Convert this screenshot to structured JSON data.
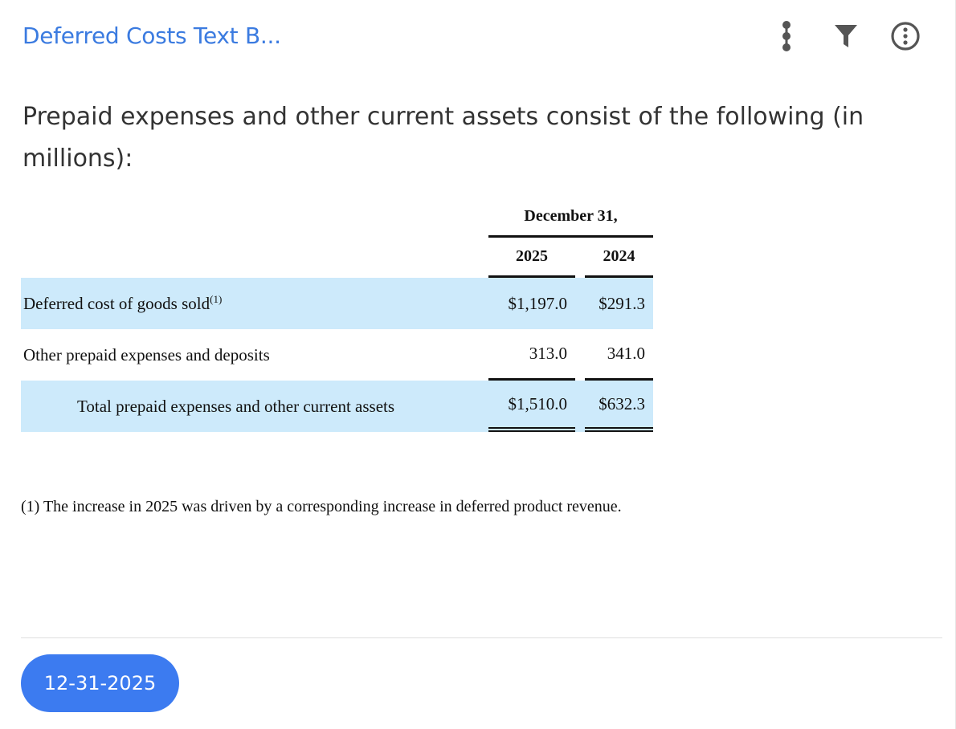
{
  "card": {
    "title": "Deferred Costs Text B...",
    "icons": [
      "more-vertical-icon",
      "filter-icon",
      "info-icon"
    ]
  },
  "intro_text": "Prepaid expenses and other current assets consist of the following (in millions):",
  "table": {
    "period_header": "December 31,",
    "year_a": "2025",
    "year_b": "2024",
    "rows": [
      {
        "label": "Deferred cost of goods sold",
        "footnote_ref": "(1)",
        "a": "$1,197.0",
        "b": "$291.3"
      },
      {
        "label": "Other prepaid expenses and deposits",
        "footnote_ref": "",
        "a": "313.0",
        "b": "341.0"
      },
      {
        "label": "Total prepaid expenses and other current assets",
        "footnote_ref": "",
        "a": "$1,510.0",
        "b": "$632.3"
      }
    ]
  },
  "footnote": "(1) The increase in 2025 was driven by a corresponding increase in deferred product revenue.",
  "date_chip": "12-31-2025",
  "colors": {
    "accent": "#3c7bf0",
    "title": "#3b7be0",
    "row_shade": "#cdeafb"
  }
}
